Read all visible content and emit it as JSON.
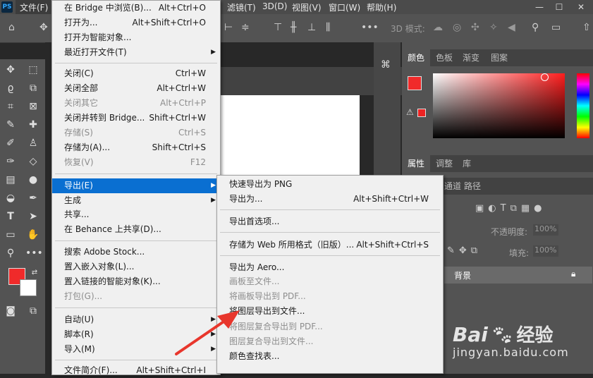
{
  "menubar": {
    "app_icon": "PS",
    "file_label": "文件(F)",
    "items": [
      "滤镜(T)",
      "3D(D)",
      "视图(V)",
      "窗口(W)",
      "帮助(H)"
    ]
  },
  "window_controls": {
    "minimize": "—",
    "maximize": "☐",
    "close": "✕"
  },
  "optionsbar": {
    "mode_label": "3D 模式:"
  },
  "panels": {
    "color_tabs": [
      "颜色",
      "色板",
      "渐变",
      "图案"
    ],
    "prop_tabs": [
      "属性",
      "调整",
      "库"
    ],
    "layer_tabs": [
      "通道",
      "路径"
    ],
    "opacity_label": "不透明度:",
    "opacity_value": "100%",
    "fill_label": "填充:",
    "fill_value": "100%",
    "layer_name": "背景"
  },
  "colors": {
    "foreground": "#f02a2a",
    "background": "#ffffff",
    "highlight": "#0a6fd1",
    "arrow": "#e8362c"
  },
  "file_menu": {
    "items": [
      {
        "label": "在 Bridge 中浏览(B)...",
        "shortcut": "Alt+Ctrl+O"
      },
      {
        "label": "打开为...",
        "shortcut": "Alt+Shift+Ctrl+O"
      },
      {
        "label": "打开为智能对象..."
      },
      {
        "label": "最近打开文件(T)",
        "submenu": true
      },
      {
        "label": "关闭(C)",
        "shortcut": "Ctrl+W"
      },
      {
        "label": "关闭全部",
        "shortcut": "Alt+Ctrl+W"
      },
      {
        "label": "关闭其它",
        "shortcut": "Alt+Ctrl+P",
        "disabled": true
      },
      {
        "label": "关闭并转到 Bridge...",
        "shortcut": "Shift+Ctrl+W"
      },
      {
        "label": "存储(S)",
        "shortcut": "Ctrl+S",
        "disabled": true
      },
      {
        "label": "存储为(A)...",
        "shortcut": "Shift+Ctrl+S"
      },
      {
        "label": "恢复(V)",
        "shortcut": "F12",
        "disabled": true
      },
      {
        "label": "导出(E)",
        "submenu": true,
        "highlighted": true
      },
      {
        "label": "生成",
        "submenu": true
      },
      {
        "label": "共享..."
      },
      {
        "label": "在 Behance 上共享(D)..."
      },
      {
        "label": "搜索 Adobe Stock..."
      },
      {
        "label": "置入嵌入对象(L)..."
      },
      {
        "label": "置入链接的智能对象(K)..."
      },
      {
        "label": "打包(G)...",
        "disabled": true
      },
      {
        "label": "自动(U)",
        "submenu": true
      },
      {
        "label": "脚本(R)",
        "submenu": true
      },
      {
        "label": "导入(M)",
        "submenu": true
      },
      {
        "label": "文件简介(F)...",
        "shortcut": "Alt+Shift+Ctrl+I"
      }
    ]
  },
  "export_menu": {
    "items": [
      {
        "label": "快速导出为 PNG"
      },
      {
        "label": "导出为...",
        "shortcut": "Alt+Shift+Ctrl+W"
      },
      {
        "label": "导出首选项..."
      },
      {
        "label": "存储为 Web 所用格式（旧版）...",
        "shortcut": "Alt+Shift+Ctrl+S"
      },
      {
        "label": "导出为 Aero..."
      },
      {
        "label": "画板至文件...",
        "disabled": true
      },
      {
        "label": "将画板导出到 PDF...",
        "disabled": true
      },
      {
        "label": "将图层导出到文件..."
      },
      {
        "label": "将图层复合导出到 PDF...",
        "disabled": true
      },
      {
        "label": "图层复合导出到文件...",
        "disabled": true
      },
      {
        "label": "颜色查找表..."
      }
    ]
  },
  "watermark": {
    "brand_left": "Bai",
    "brand_right": "经验",
    "url": "jingyan.baidu.com"
  }
}
